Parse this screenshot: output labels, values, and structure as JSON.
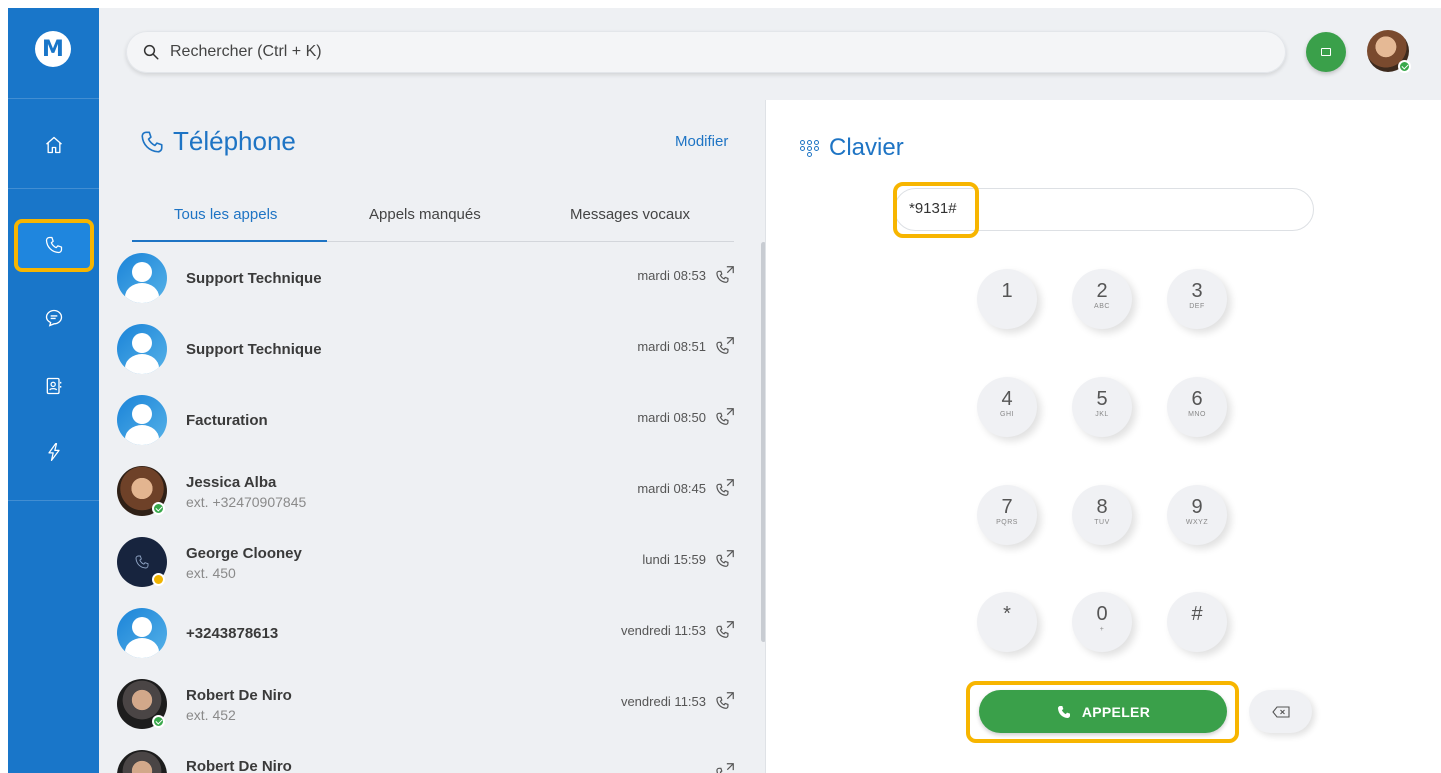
{
  "app": {
    "logo_letter": "M"
  },
  "search": {
    "placeholder": "Rechercher (Ctrl + K)"
  },
  "sidebar": {
    "items": [
      {
        "icon": "home-icon"
      },
      {
        "icon": "phone-icon"
      },
      {
        "icon": "chat-icon"
      },
      {
        "icon": "contacts-icon"
      },
      {
        "icon": "lightning-icon"
      }
    ]
  },
  "phone_panel": {
    "title": "Téléphone",
    "modify_label": "Modifier",
    "tabs": [
      {
        "label": "Tous les appels"
      },
      {
        "label": "Appels manqués"
      },
      {
        "label": "Messages vocaux"
      }
    ],
    "calls": [
      {
        "name": "Support Technique",
        "ext": "",
        "time": "mardi 08:53"
      },
      {
        "name": "Support Technique",
        "ext": "",
        "time": "mardi 08:51"
      },
      {
        "name": "Facturation",
        "ext": "",
        "time": "mardi 08:50"
      },
      {
        "name": "Jessica Alba",
        "ext": "ext. +32470907845",
        "time": "mardi 08:45"
      },
      {
        "name": "George Clooney",
        "ext": "ext. 450",
        "time": "lundi 15:59"
      },
      {
        "name": "+3243878613",
        "ext": "",
        "time": "vendredi 11:53"
      },
      {
        "name": "Robert De Niro",
        "ext": "ext. 452",
        "time": "vendredi 11:53"
      },
      {
        "name": "Robert De Niro",
        "ext": "",
        "time": ""
      }
    ]
  },
  "keypad": {
    "title": "Clavier",
    "dial_value": "*9131#",
    "keys": [
      {
        "digit": "1",
        "letters": ""
      },
      {
        "digit": "2",
        "letters": "ABC"
      },
      {
        "digit": "3",
        "letters": "DEF"
      },
      {
        "digit": "4",
        "letters": "GHI"
      },
      {
        "digit": "5",
        "letters": "JKL"
      },
      {
        "digit": "6",
        "letters": "MNO"
      },
      {
        "digit": "7",
        "letters": "PQRS"
      },
      {
        "digit": "8",
        "letters": "TUV"
      },
      {
        "digit": "9",
        "letters": "WXYZ"
      },
      {
        "digit": "*",
        "letters": ""
      },
      {
        "digit": "0",
        "letters": "+"
      },
      {
        "digit": "#",
        "letters": ""
      }
    ],
    "call_label": "APPELER"
  },
  "colors": {
    "brand_blue": "#1976c9",
    "accent_text": "#1e74c4",
    "call_green": "#3aa04a",
    "highlight": "#f7b500"
  }
}
